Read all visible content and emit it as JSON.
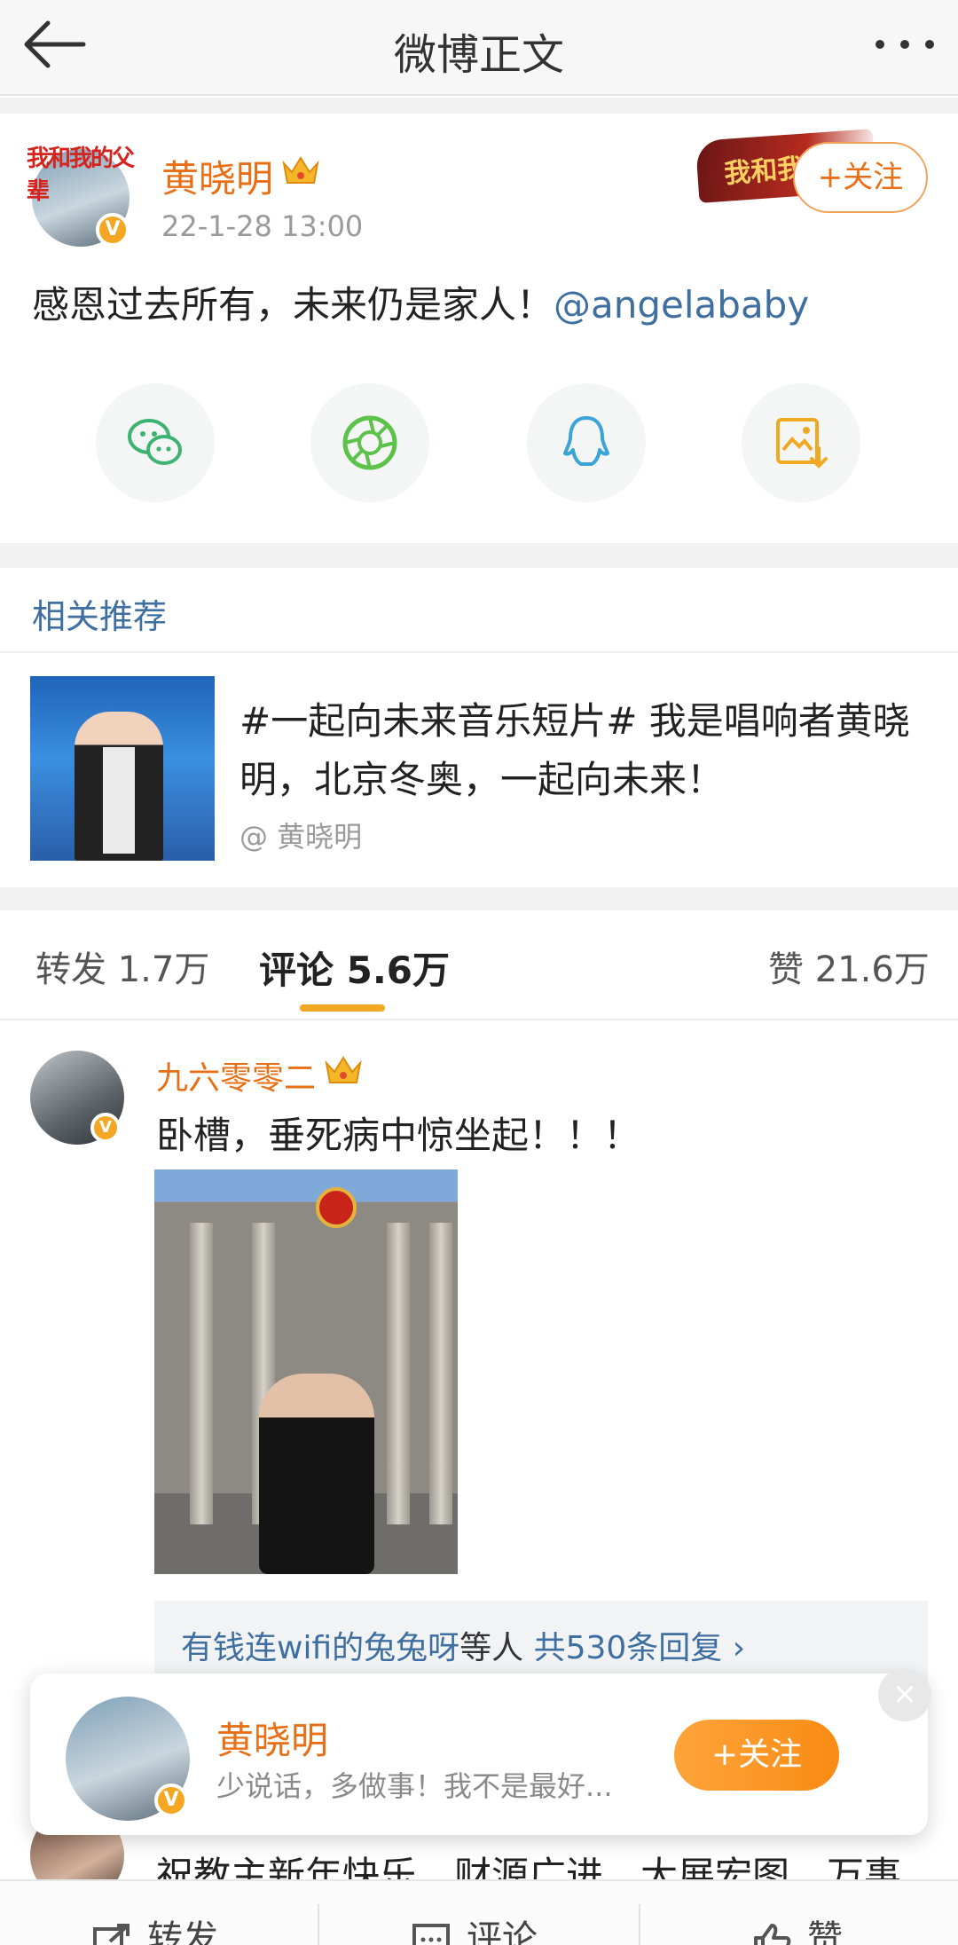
{
  "header": {
    "title": "微博正文"
  },
  "post": {
    "author": "黄晓明",
    "avatar_banner": "我和我的父辈",
    "time": "22-1-28 13:00",
    "banner_deco": "我和我",
    "follow_label": "+关注",
    "text": "感恩过去所有，未来仍是家人！",
    "mention": "@angelababy"
  },
  "share_icons": [
    "wechat-icon",
    "moments-icon",
    "qq-icon",
    "save-image-icon"
  ],
  "related": {
    "title": "相关推荐",
    "text": "#一起向未来音乐短片# 我是唱响者黄晓明，北京冬奥，一起向未来！",
    "author": "@ 黄晓明"
  },
  "tabs": {
    "repost": "转发 1.7万",
    "comment": "评论 5.6万",
    "like": "赞 21.6万"
  },
  "comment": {
    "name": "九六零零二",
    "text": "卧槽，垂死病中惊坐起！！！",
    "replies_prefix": "有钱连wifi的兔兔呀",
    "replies_mid": "等人",
    "replies_count": "共530条回复 ›"
  },
  "next_comment": {
    "text": "祝教主新年快乐，财源广进，大展宏图，万事"
  },
  "popup": {
    "name": "黄晓明",
    "desc": "少说话，多做事！我不是最好...",
    "follow_label": "+关注",
    "close": "×"
  },
  "bottom_bar": {
    "repost": "转发",
    "comment": "评论",
    "like": "赞"
  },
  "colors": {
    "accent": "#e86f15",
    "link": "#3f6fa0",
    "badge": "#f5a623"
  }
}
